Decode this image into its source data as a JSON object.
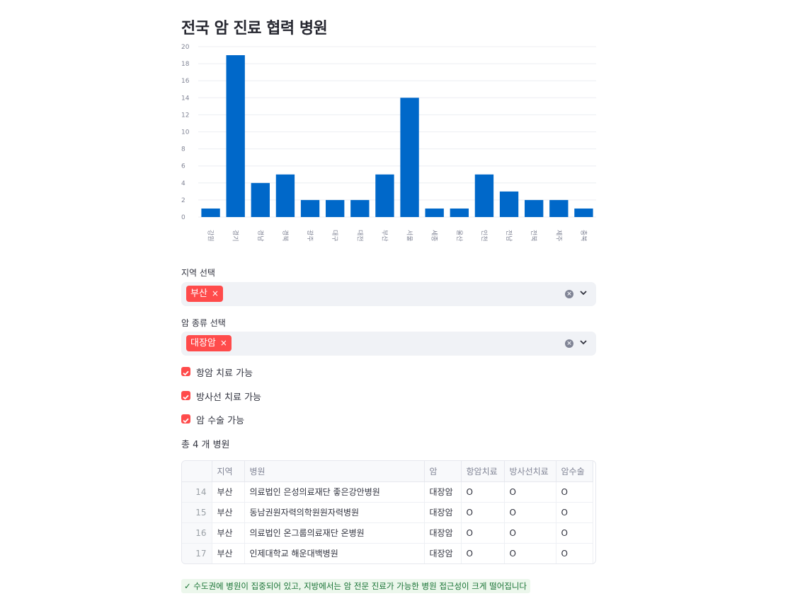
{
  "page_title": "전국 암 진료 협력 병원",
  "chart_data": {
    "type": "bar",
    "categories": [
      "강원",
      "경기",
      "경남",
      "경북",
      "광주",
      "대구",
      "대전",
      "부산",
      "서울",
      "세종",
      "울산",
      "인천",
      "전남",
      "전북",
      "제주",
      "충북"
    ],
    "values": [
      1,
      19,
      4,
      5,
      2,
      2,
      2,
      5,
      14,
      1,
      1,
      5,
      3,
      2,
      2,
      1
    ],
    "y_ticks": [
      "0",
      "2",
      "4",
      "6",
      "8",
      "10",
      "12",
      "14",
      "16",
      "18",
      "20"
    ],
    "ylim": [
      0,
      20
    ],
    "grid": true,
    "bar_color": "#0068c9"
  },
  "region_select": {
    "label": "지역 선택",
    "selected": "부산",
    "remove_glyph": "×",
    "clear_glyph": "×"
  },
  "cancer_select": {
    "label": "암 종류 선택",
    "selected": "대장암",
    "remove_glyph": "×",
    "clear_glyph": "×"
  },
  "checkboxes": [
    {
      "label": "항암 치료 가능",
      "checked": true
    },
    {
      "label": "방사선 치료 가능",
      "checked": true
    },
    {
      "label": "암 수술 가능",
      "checked": true
    }
  ],
  "total_text": "총 4 개 병원",
  "table": {
    "columns": [
      "",
      "지역",
      "병원",
      "암",
      "항암치료",
      "방사선치료",
      "암수술"
    ],
    "rows": [
      {
        "index": "14",
        "region": "부산",
        "hospital": "의료법인 은성의료재단 좋은강안병원",
        "cancer": "대장암",
        "chemo": "O",
        "radiation": "O",
        "surgery": "O"
      },
      {
        "index": "15",
        "region": "부산",
        "hospital": "동남권원자력의학원원자력병원",
        "cancer": "대장암",
        "chemo": "O",
        "radiation": "O",
        "surgery": "O"
      },
      {
        "index": "16",
        "region": "부산",
        "hospital": "의료법인 온그룹의료재단 온병원",
        "cancer": "대장암",
        "chemo": "O",
        "radiation": "O",
        "surgery": "O"
      },
      {
        "index": "17",
        "region": "부산",
        "hospital": "인제대학교 해운대백병원",
        "cancer": "대장암",
        "chemo": "O",
        "radiation": "O",
        "surgery": "O"
      }
    ]
  },
  "success_message": "✓ 수도권에 병원이 집중되어 있고, 지방에서는 암 전문 진료가 가능한 병원 접근성이 크게 떨어집니다",
  "colors": {
    "accent": "#ff4b4b",
    "success_bg": "#ecf7ec",
    "success_text": "#177233"
  }
}
